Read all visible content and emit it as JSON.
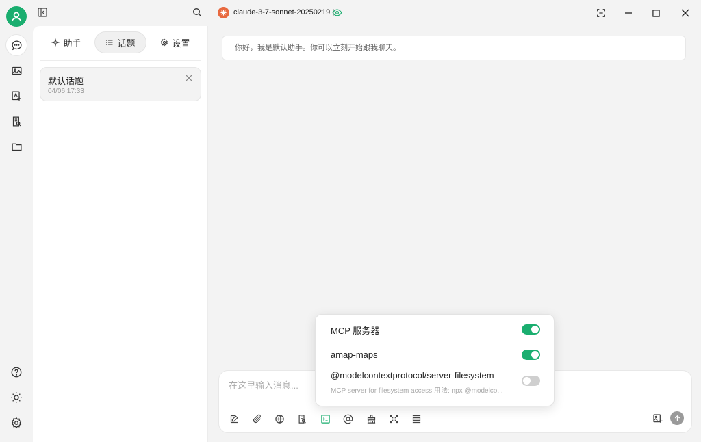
{
  "colors": {
    "accent": "#1aae6f",
    "send_disabled": "#9a9a9a",
    "model_badge": "#e8693f"
  },
  "topbar": {
    "model_name": "claude-3-7-sonnet-20250219 |",
    "icons": [
      "sidebar-toggle-icon",
      "search-icon",
      "eye-icon",
      "screen-capture-icon",
      "minimize-icon",
      "maximize-icon",
      "close-icon"
    ]
  },
  "rail": {
    "items": [
      {
        "name": "chat-icon",
        "active": true
      },
      {
        "name": "image-icon",
        "active": false
      },
      {
        "name": "translate-icon",
        "active": false
      },
      {
        "name": "knowledge-icon",
        "active": false
      },
      {
        "name": "folder-icon",
        "active": false
      }
    ],
    "bottom": [
      "help-icon",
      "theme-icon",
      "settings-icon"
    ]
  },
  "sidebar": {
    "tabs": [
      {
        "label": "助手",
        "icon": "sparkle-icon",
        "active": false
      },
      {
        "label": "话题",
        "icon": "list-icon",
        "active": true
      },
      {
        "label": "设置",
        "icon": "gear-icon",
        "active": false
      }
    ],
    "topics": [
      {
        "title": "默认话题",
        "time": "04/06 17:33"
      }
    ]
  },
  "chat": {
    "welcome": "你好，我是默认助手。你可以立刻开始跟我聊天。"
  },
  "composer": {
    "placeholder": "在这里输入消息...",
    "tools": [
      "new-topic-icon",
      "attach-icon",
      "web-search-icon",
      "knowledge-search-icon",
      "mcp-terminal-icon",
      "mention-icon",
      "clear-icon",
      "expand-icon",
      "collapse-icon"
    ],
    "active_tool": "mcp-terminal-icon"
  },
  "mcp_popover": {
    "header": "MCP 服务器",
    "header_enabled": true,
    "servers": [
      {
        "name": "amap-maps",
        "description": "",
        "enabled": true
      },
      {
        "name": "@modelcontextprotocol/server-filesystem",
        "description": "MCP server for filesystem access 用法: npx @modelco...",
        "enabled": false
      }
    ]
  }
}
